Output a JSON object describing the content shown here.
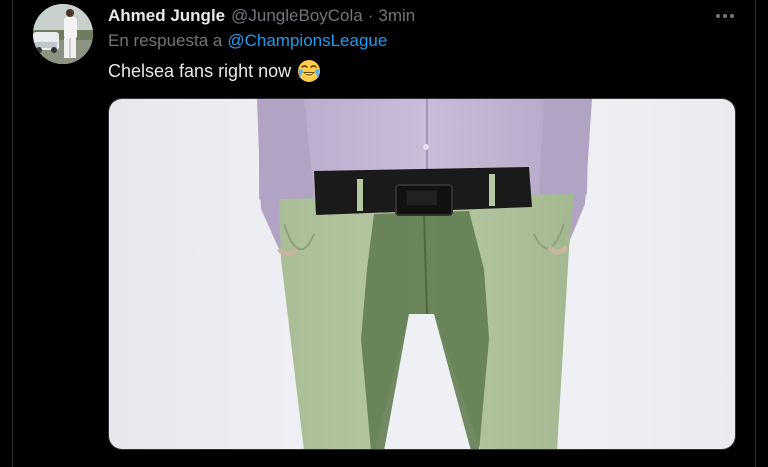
{
  "tweet": {
    "author": {
      "display_name": "Ahmed Jungle",
      "handle": "@JungleBoyCola",
      "separator": "·",
      "time": "3min",
      "avatar_icon": "user-photo-avatar"
    },
    "reply": {
      "prefix": "En respuesta a",
      "mention": "@ChampionsLeague"
    },
    "text": "Chelsea fans right now",
    "emoji": "face-with-tears-of-joy-icon",
    "more_icon": "more-horizontal-icon",
    "media": {
      "kind": "photo",
      "subject": "person in lavender shirt and green trousers with dark wet stain"
    }
  },
  "colors": {
    "background": "#000000",
    "text_primary": "#e7e9ea",
    "text_secondary": "#71767b",
    "link": "#1d9bf0",
    "border": "#2f3336"
  }
}
